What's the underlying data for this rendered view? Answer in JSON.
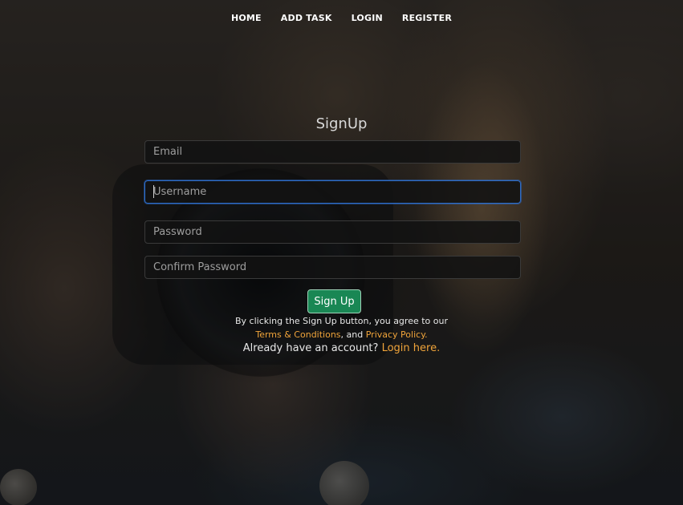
{
  "nav": {
    "items": [
      {
        "label": "HOME"
      },
      {
        "label": "ADD TASK"
      },
      {
        "label": "LOGIN"
      },
      {
        "label": "REGISTER"
      }
    ]
  },
  "form": {
    "title": "SignUp",
    "email_placeholder": "Email",
    "username_placeholder": "Username",
    "password_placeholder": "Password",
    "confirm_password_placeholder": "Confirm Password",
    "submit_label": "Sign Up",
    "terms_prefix": "By clicking the Sign Up button, you agree to our",
    "terms_link": "Terms & Conditions",
    "terms_joiner": ", and",
    "privacy_link": "Privacy Policy.",
    "already_text": "Already have an account?",
    "login_link": "Login here."
  },
  "colors": {
    "accent_link": "#f0a43a",
    "button_green": "#198754",
    "focus_border": "#2d6cc7"
  }
}
